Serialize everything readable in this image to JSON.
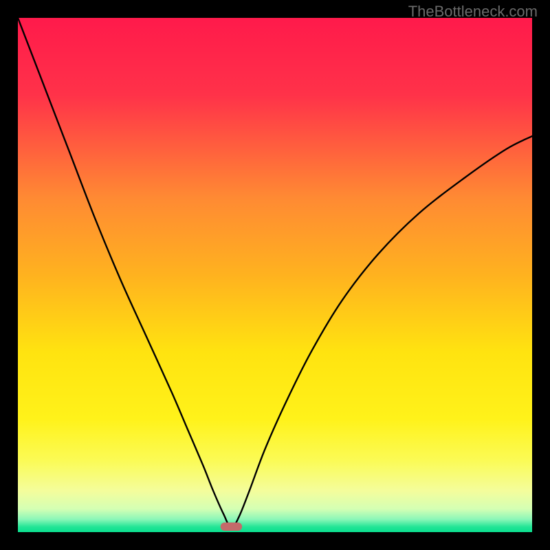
{
  "watermark": "TheBottleneck.com",
  "chart_data": {
    "type": "line",
    "title": "",
    "xlabel": "",
    "ylabel": "",
    "xlim": [
      0,
      100
    ],
    "ylim": [
      0,
      100
    ],
    "series": [
      {
        "name": "bottleneck-curve",
        "x": [
          0,
          5,
          10,
          15,
          20,
          25,
          30,
          33,
          36,
          38,
          40,
          41.5,
          43,
          45,
          48,
          52,
          57,
          63,
          70,
          78,
          87,
          95,
          100
        ],
        "values": [
          100,
          87,
          74,
          61,
          49,
          38,
          27,
          20,
          13,
          8,
          3.5,
          0.8,
          3,
          8,
          16,
          25,
          35,
          45,
          54,
          62,
          69,
          74.5,
          77
        ]
      }
    ],
    "marker": {
      "name": "optimum-marker",
      "x": 41.5,
      "width_pct": 4.2,
      "height_pct": 1.6,
      "color": "#c46a6a"
    },
    "gradient_stops": [
      {
        "pos": 0.0,
        "color": "#ff1a4b"
      },
      {
        "pos": 0.15,
        "color": "#ff3249"
      },
      {
        "pos": 0.35,
        "color": "#ff8a33"
      },
      {
        "pos": 0.5,
        "color": "#ffb21f"
      },
      {
        "pos": 0.65,
        "color": "#ffe310"
      },
      {
        "pos": 0.78,
        "color": "#fff21a"
      },
      {
        "pos": 0.86,
        "color": "#fbfb55"
      },
      {
        "pos": 0.92,
        "color": "#f4fd9c"
      },
      {
        "pos": 0.955,
        "color": "#d4ffb4"
      },
      {
        "pos": 0.975,
        "color": "#8cf7b8"
      },
      {
        "pos": 0.99,
        "color": "#22e596"
      },
      {
        "pos": 1.0,
        "color": "#0adf8f"
      }
    ]
  }
}
